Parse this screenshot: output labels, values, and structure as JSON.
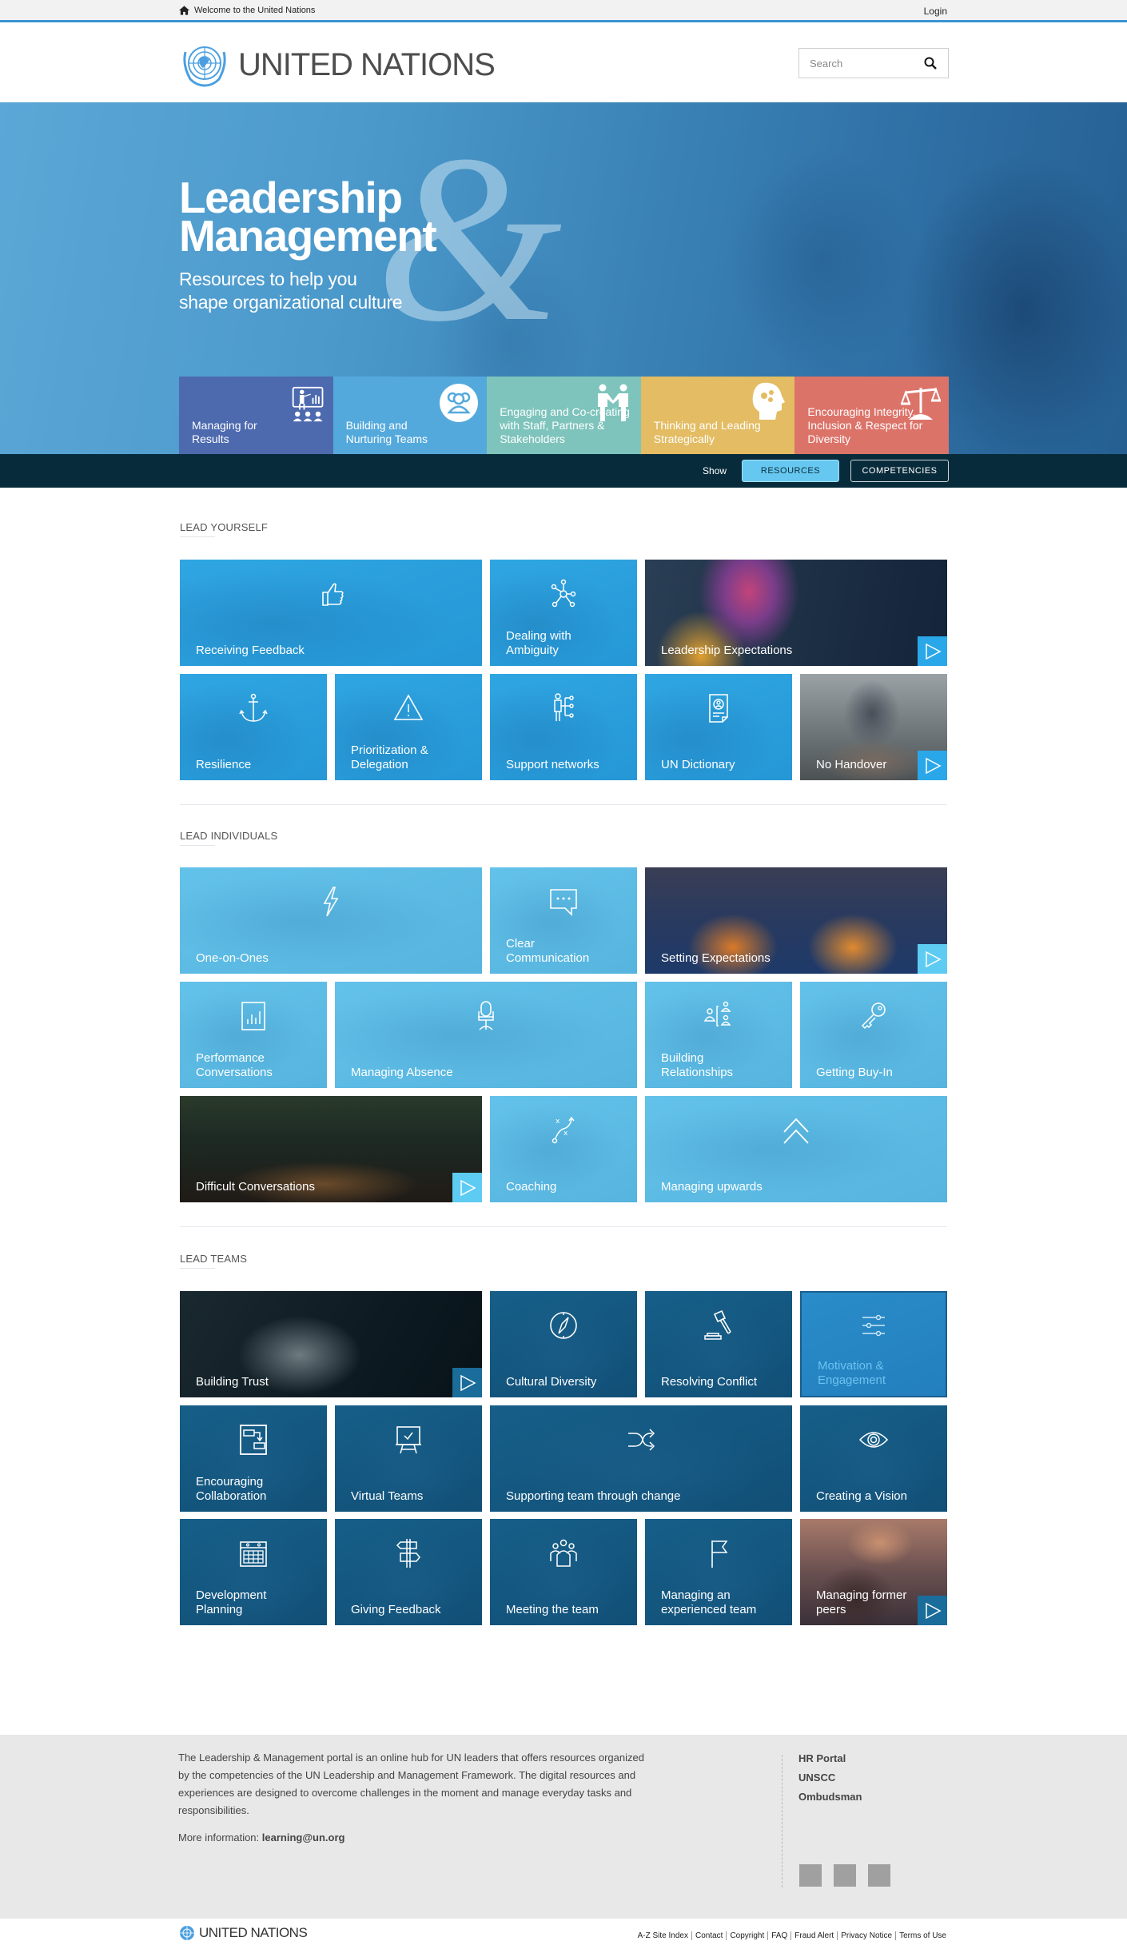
{
  "topbar": {
    "welcome": "Welcome to the United Nations",
    "login": "Login"
  },
  "header": {
    "logo_text": "UNITED NATIONS",
    "search_placeholder": "Search"
  },
  "hero": {
    "title_line1": "Leadership",
    "title_line2": "Management",
    "ampersand": "&",
    "subtitle_line1": "Resources to help you",
    "subtitle_line2": "shape organizational culture",
    "categories": [
      {
        "label": "Managing for Results",
        "icon": "presentation-icon",
        "color": "#4d6aaf"
      },
      {
        "label": "Building and Nurturing Teams",
        "icon": "team-icon",
        "color": "#54a9dc"
      },
      {
        "label": "Engaging and Co-creating with Staff, Partners & Stakeholders",
        "icon": "handshake-people-icon",
        "color": "#7ec4bc"
      },
      {
        "label": "Thinking and Leading Strategically",
        "icon": "head-gears-icon",
        "color": "#e3bc63"
      },
      {
        "label": "Encouraging Integrity, Inclusion & Respect for Diversity",
        "icon": "scales-icon",
        "color": "#dc7369"
      }
    ]
  },
  "showbar": {
    "show_label": "Show",
    "resources": "RESOURCES",
    "competencies": "COMPETENCIES",
    "active": "RESOURCES"
  },
  "sections": [
    {
      "heading": "LEAD YOURSELF",
      "tiles": [
        {
          "label": "Receiving Feedback",
          "icon": "thumbs-up-icon"
        },
        {
          "label": "Dealing with Ambiguity",
          "icon": "network-icon"
        },
        {
          "label": "Leadership Expectations",
          "video": true
        },
        {
          "label": "Resilience",
          "icon": "anchor-icon"
        },
        {
          "label": "Prioritization & Delegation",
          "icon": "warning-icon"
        },
        {
          "label": "Support networks",
          "icon": "person-network-icon"
        },
        {
          "label": "UN Dictionary",
          "icon": "id-document-icon"
        },
        {
          "label": "No Handover",
          "video": true
        }
      ]
    },
    {
      "heading": "LEAD INDIVIDUALS",
      "tiles": [
        {
          "label": "One-on-Ones",
          "icon": "lightning-icon"
        },
        {
          "label": "Clear Communication",
          "icon": "chat-bubble-icon"
        },
        {
          "label": "Setting Expectations",
          "video": true
        },
        {
          "label": "Performance Conversations",
          "icon": "bar-chart-icon"
        },
        {
          "label": "Managing Absence",
          "icon": "office-chair-icon"
        },
        {
          "label": "Building Relationships",
          "icon": "relationship-icon"
        },
        {
          "label": "Getting Buy-In",
          "icon": "key-icon"
        },
        {
          "label": "Difficult Conversations",
          "video": true
        },
        {
          "label": "Coaching",
          "icon": "strategy-play-icon"
        },
        {
          "label": "Managing upwards",
          "icon": "double-chevron-up-icon"
        }
      ]
    },
    {
      "heading": "LEAD TEAMS",
      "tiles": [
        {
          "label": "Building Trust",
          "video": true
        },
        {
          "label": "Cultural Diversity",
          "icon": "compass-icon"
        },
        {
          "label": "Resolving Conflict",
          "icon": "gavel-icon"
        },
        {
          "label": "Motivation & Engagement",
          "icon": "sliders-icon",
          "highlighted": true
        },
        {
          "label": "Encouraging Collaboration",
          "icon": "flowchart-icon"
        },
        {
          "label": "Virtual Teams",
          "icon": "easel-check-icon"
        },
        {
          "label": "Supporting team through change",
          "icon": "shuffle-icon"
        },
        {
          "label": "Creating a Vision",
          "icon": "eye-icon"
        },
        {
          "label": "Development Planning",
          "icon": "calendar-icon"
        },
        {
          "label": "Giving Feedback",
          "icon": "signpost-icon"
        },
        {
          "label": "Meeting the team",
          "icon": "group-icon"
        },
        {
          "label": "Managing an experienced team",
          "icon": "flag-icon"
        },
        {
          "label": "Managing former peers",
          "video": true
        }
      ]
    }
  ],
  "footer": {
    "about": "The Leadership & Management portal is an online hub for UN leaders that offers resources organized by the competencies of the UN Leadership and Management Framework. The digital resources and experiences are designed to overcome challenges in the moment and manage everyday tasks and responsibilities.",
    "more_label": "More information: ",
    "email": "learning@un.org",
    "links": [
      "HR Portal",
      "UNSCC",
      "Ombudsman"
    ],
    "bottom_logo_text": "UNITED NATIONS",
    "legal_links": [
      "A-Z Site Index",
      "Contact",
      "Copyright",
      "FAQ",
      "Fraud Alert",
      "Privacy Notice",
      "Terms of Use"
    ]
  },
  "colors": {
    "accent_blue": "#3b93d4",
    "dark_bar": "#082b3b",
    "lead_yourself_tile": "#2a9fdc",
    "lead_individuals_tile": "#5dbde6",
    "lead_teams_tile": "#13577f"
  }
}
